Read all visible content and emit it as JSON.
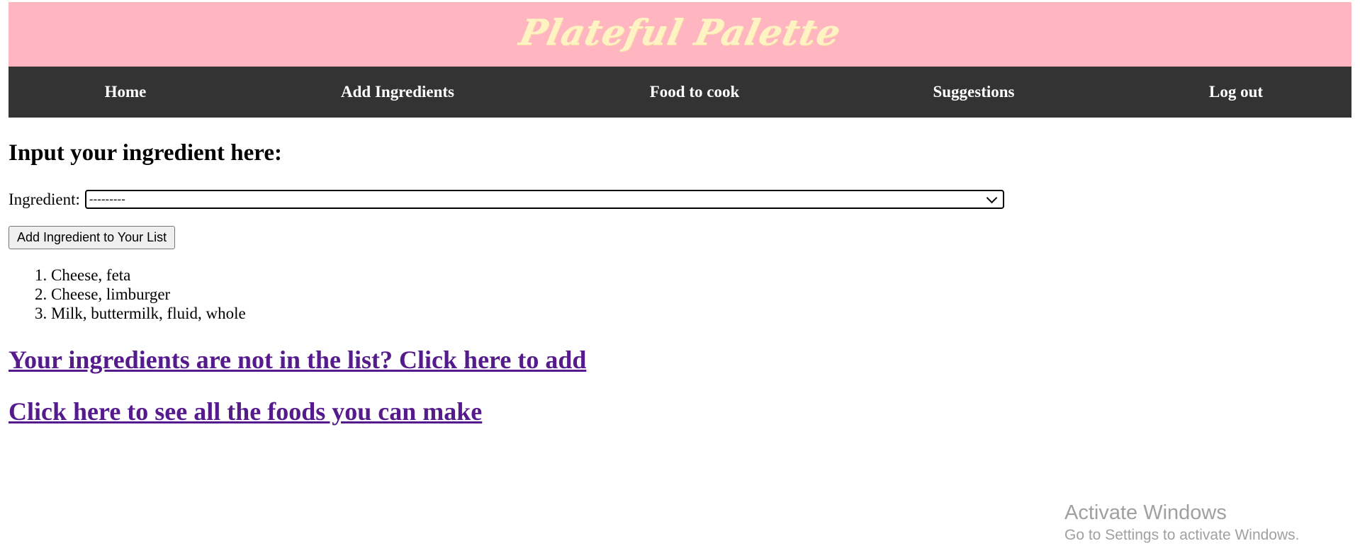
{
  "header": {
    "brand": "Plateful Palette",
    "brand_color": "#fff3c4",
    "banner_color": "#ffb6c1"
  },
  "nav": {
    "background": "#333333",
    "items": [
      {
        "label": "Home"
      },
      {
        "label": "Add Ingredients"
      },
      {
        "label": "Food to cook"
      },
      {
        "label": "Suggestions"
      },
      {
        "label": "Log out"
      }
    ]
  },
  "main": {
    "heading": "Input your ingredient here:",
    "ingredient_label": "Ingredient:",
    "select_value": "---------",
    "add_button": "Add Ingredient to Your List",
    "ingredients": [
      "Cheese, feta",
      "Cheese, limburger",
      "Milk, buttermilk, fluid, whole"
    ],
    "link_add": "Your ingredients are not in the list? Click here to add",
    "link_foods": "Click here to see all the foods you can make",
    "link_color": "#551a8b"
  },
  "watermark": {
    "title": "Activate Windows",
    "subtitle": "Go to Settings to activate Windows."
  }
}
